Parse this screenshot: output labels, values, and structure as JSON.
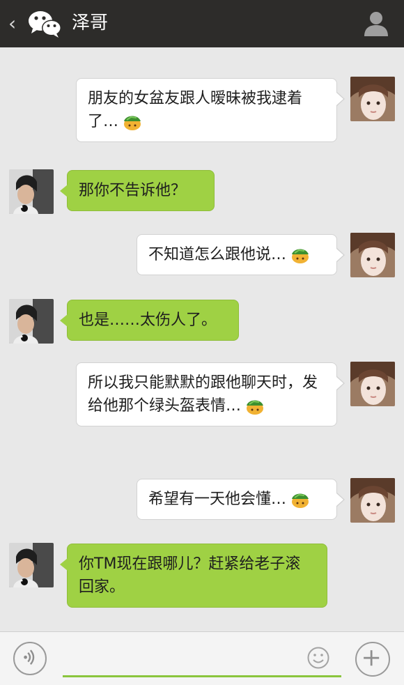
{
  "header": {
    "back_glyph": "‹",
    "title": "泽哥",
    "background": "#2d2c2a"
  },
  "messages": [
    {
      "side": "right",
      "sender": "self",
      "text": "朋友的女盆友跟人暧昧被我逮着了…",
      "emoji": "turtle-emoji"
    },
    {
      "side": "left",
      "sender": "friend",
      "text": "那你不告诉他？"
    },
    {
      "side": "right",
      "sender": "self",
      "text": "不知道怎么跟他说…",
      "emoji": "turtle-emoji"
    },
    {
      "side": "left",
      "sender": "friend",
      "text": "也是……太伤人了。"
    },
    {
      "side": "right",
      "sender": "self",
      "text": "所以我只能默默的跟他聊天时，发给他那个绿头盔表情…",
      "emoji": "turtle-emoji"
    },
    {
      "side": "right",
      "sender": "self",
      "text": "希望有一天他会懂…",
      "emoji": "turtle-emoji"
    },
    {
      "side": "left",
      "sender": "friend",
      "text": "你TM现在跟哪儿？赶紧给老子滚回家。"
    }
  ],
  "composer": {
    "input_value": "",
    "accent_color": "#8ac53d"
  },
  "colors": {
    "chat_background": "#e8e8e8",
    "incoming_bubble": "#9fd144",
    "outgoing_bubble": "#ffffff"
  }
}
